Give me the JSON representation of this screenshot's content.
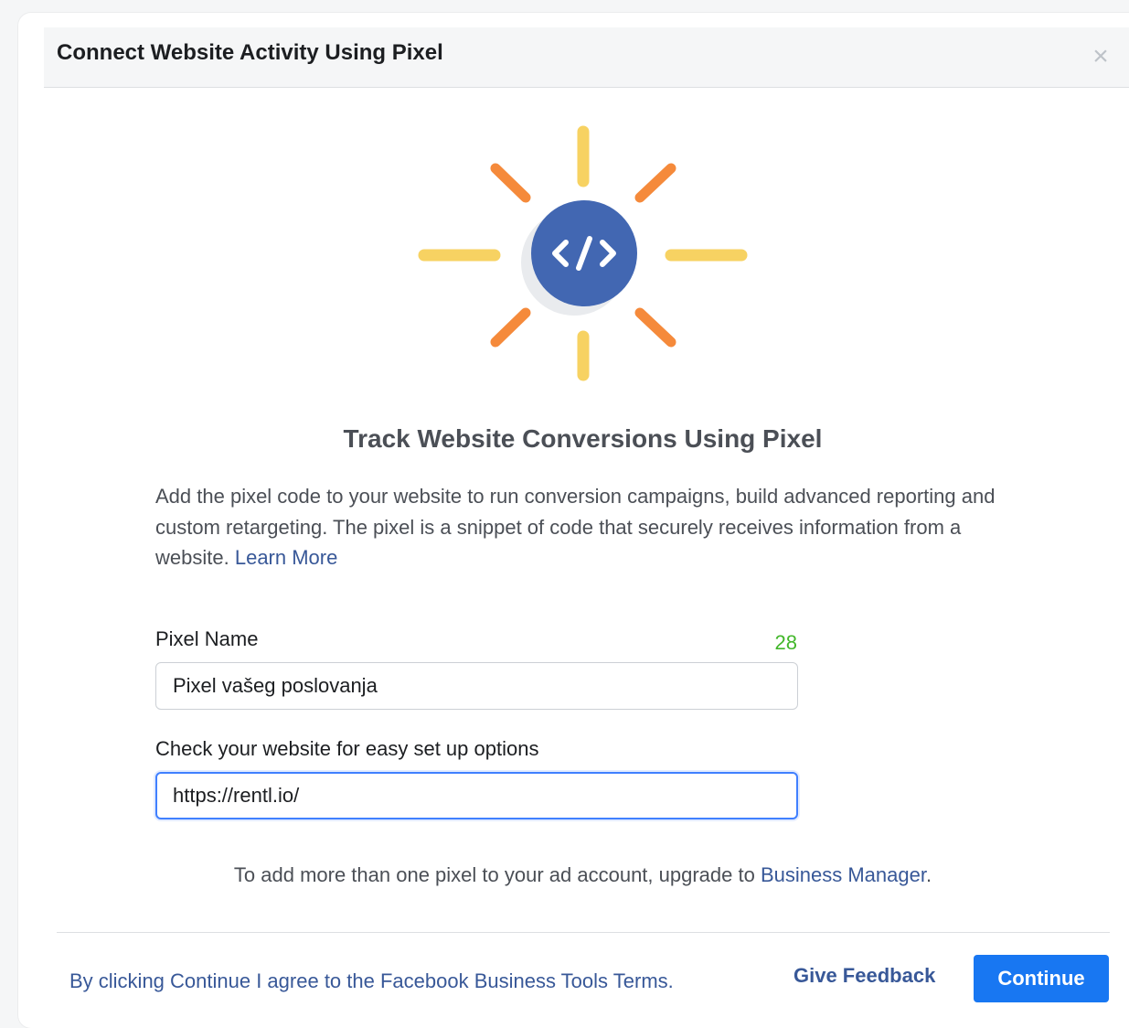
{
  "dialog": {
    "title": "Connect Website Activity Using Pixel",
    "close_label": "×"
  },
  "illustration": {
    "icon": "code-icon",
    "colors": {
      "circle": "#4267b2",
      "ray_long": "#f7d262",
      "ray_short": "#f58a3b"
    }
  },
  "main": {
    "heading": "Track Website Conversions Using Pixel",
    "description": "Add the pixel code to your website to run conversion campaigns, build advanced reporting and custom retargeting. The pixel is a snippet of code that securely receives information from a website.",
    "learn_more": "Learn More"
  },
  "form": {
    "pixel_name_label": "Pixel Name",
    "pixel_name_count": "28",
    "pixel_name_value": "Pixel vašeg poslovanja",
    "website_label": "Check your website for easy set up options",
    "website_value": "https://rentl.io/"
  },
  "upgrade": {
    "text": "To add more than one pixel to your ad account, upgrade to ",
    "link": "Business Manager",
    "suffix": "."
  },
  "footer": {
    "terms": "By clicking Continue I agree to the Facebook Business Tools Terms.",
    "feedback": "Give Feedback",
    "continue": "Continue"
  }
}
